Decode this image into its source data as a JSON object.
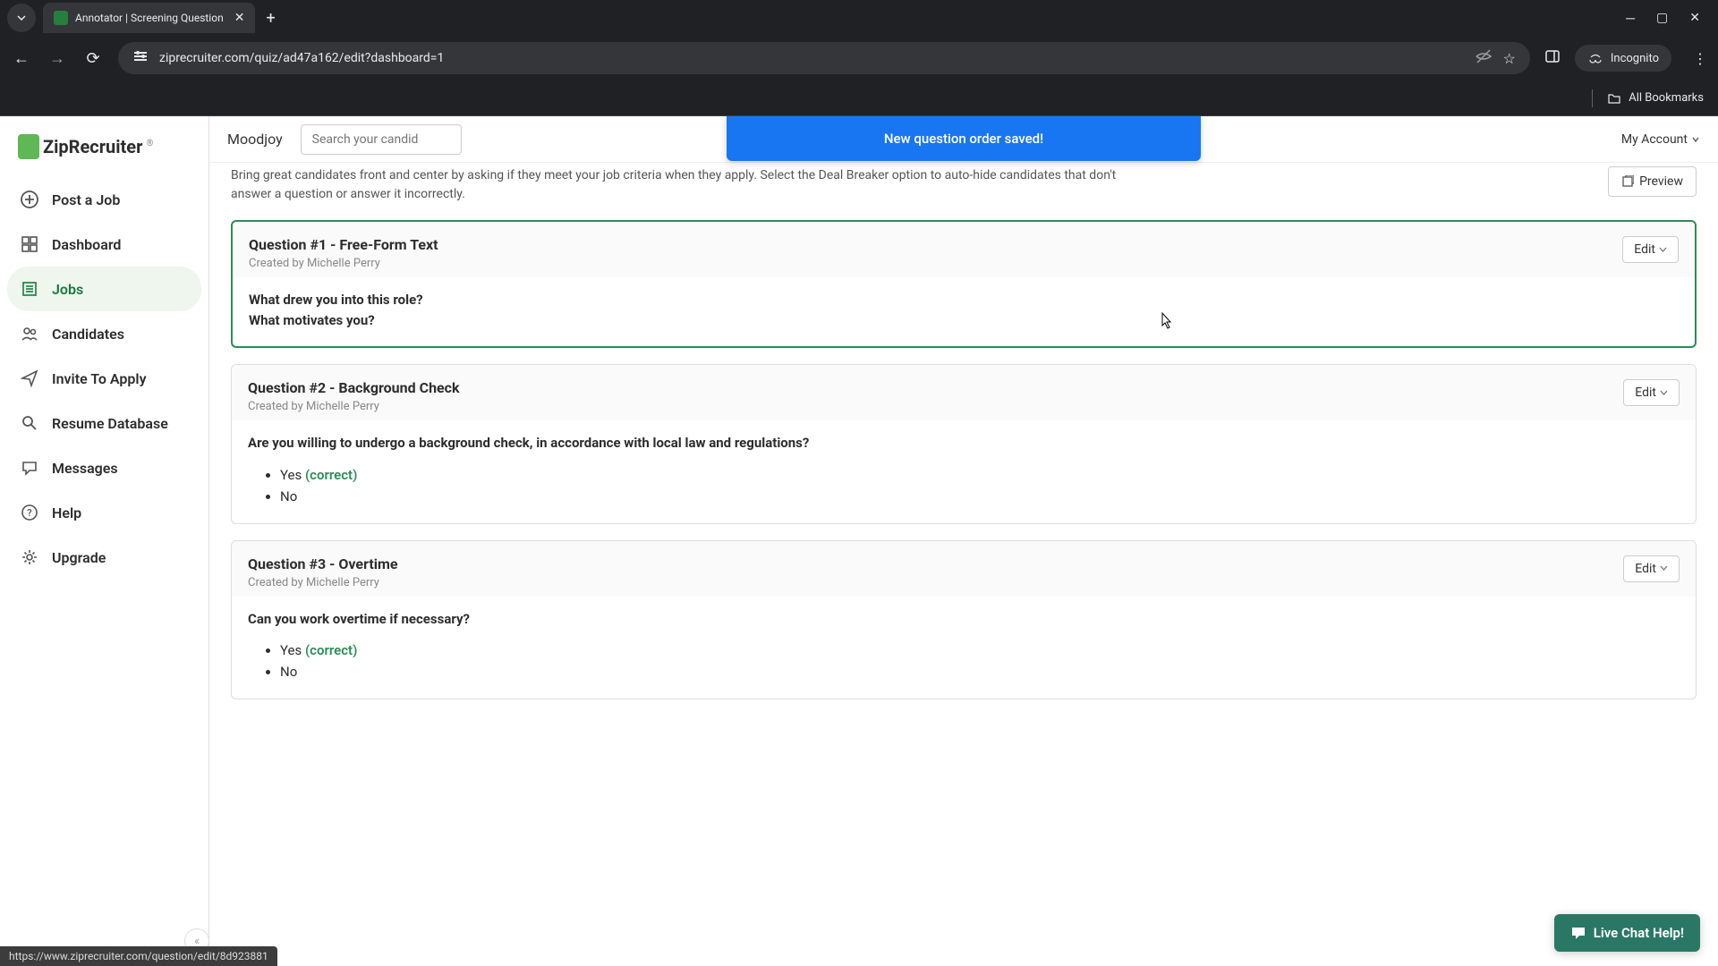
{
  "browser": {
    "tab_title": "Annotator | Screening Question",
    "url": "ziprecruiter.com/quiz/ad47a162/edit?dashboard=1",
    "incognito_label": "Incognito",
    "bookmarks_label": "All Bookmarks"
  },
  "logo": {
    "text": "ZipRecruiter"
  },
  "sidebar": {
    "items": [
      {
        "label": "Post a Job"
      },
      {
        "label": "Dashboard"
      },
      {
        "label": "Jobs"
      },
      {
        "label": "Candidates"
      },
      {
        "label": "Invite To Apply"
      },
      {
        "label": "Resume Database"
      },
      {
        "label": "Messages"
      },
      {
        "label": "Help"
      },
      {
        "label": "Upgrade"
      }
    ]
  },
  "topbar": {
    "company": "Moodjoy",
    "search_placeholder": "Search your candid",
    "account_label": "My Account"
  },
  "toast": {
    "message": "New question order saved!"
  },
  "intro": {
    "line1": "Bring great candidates front and center by asking if they meet your job criteria when they apply. Select the Deal Breaker option to auto-hide candidates that don't",
    "line2": "answer a question or answer it incorrectly."
  },
  "preview_label": "Preview",
  "edit_label": "Edit",
  "questions": [
    {
      "title": "Question #1 - Free-Form Text",
      "created_by": "Created by Michelle Perry",
      "text_line1": "What drew you into this role?",
      "text_line2": "What motivates you?"
    },
    {
      "title": "Question #2 - Background Check",
      "created_by": "Created by Michelle Perry",
      "text": "Are you willing to undergo a background check, in accordance with local law and regulations?",
      "answers": [
        {
          "label": "Yes",
          "correct_label": "(correct)"
        },
        {
          "label": "No"
        }
      ]
    },
    {
      "title": "Question #3 - Overtime",
      "created_by": "Created by Michelle Perry",
      "text": "Can you work overtime if necessary?",
      "answers": [
        {
          "label": "Yes",
          "correct_label": "(correct)"
        },
        {
          "label": "No"
        }
      ]
    }
  ],
  "chat": {
    "label": "Live Chat Help!"
  },
  "status": {
    "url": "https://www.ziprecruiter.com/question/edit/8d923881"
  }
}
